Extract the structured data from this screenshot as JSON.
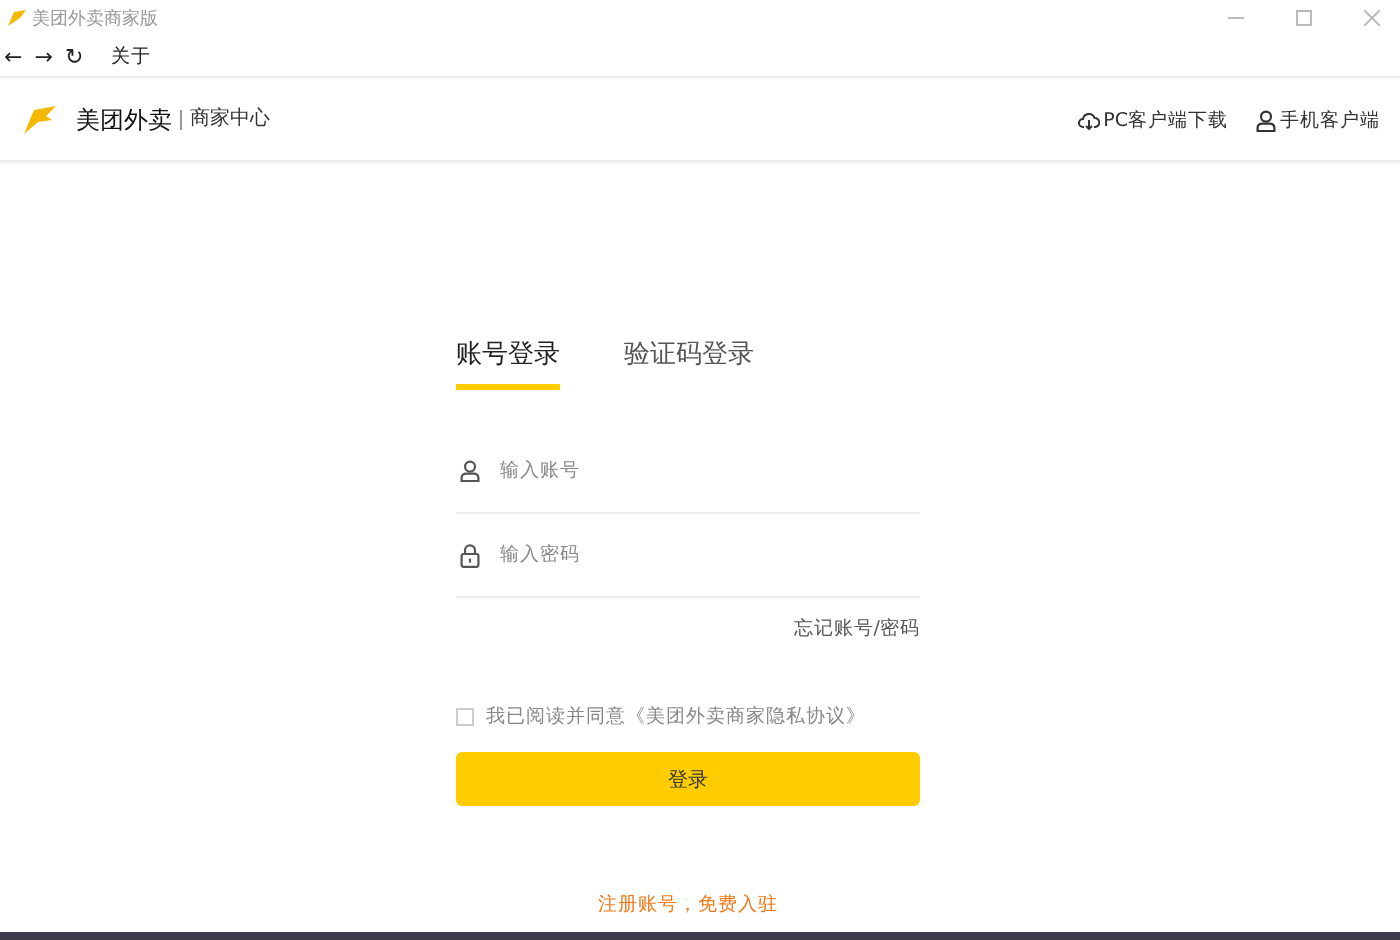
{
  "window": {
    "title": "美团外卖商家版"
  },
  "nav": {
    "back": "←",
    "forward": "→",
    "reload": "↻",
    "about": "关于"
  },
  "header": {
    "brand": "美团外卖",
    "subtitle": "商家中心",
    "links": [
      {
        "kind": "cloud",
        "label": "PC客户端下载"
      },
      {
        "kind": "person",
        "label": "手机客户端"
      }
    ]
  },
  "tabs": [
    {
      "label": "账号登录",
      "selected": true
    },
    {
      "label": "验证码登录",
      "selected": false
    }
  ],
  "fields": [
    {
      "kind": "person",
      "placeholder": "输入账号"
    },
    {
      "kind": "lock",
      "placeholder": "输入密码"
    }
  ],
  "forgot_link": "忘记账号/密码",
  "agreement": {
    "checked": false,
    "text": "我已阅读并同意《美团外卖商家隐私协议》"
  },
  "login_button": "登录",
  "register_link": "注册账号，免费入驻"
}
